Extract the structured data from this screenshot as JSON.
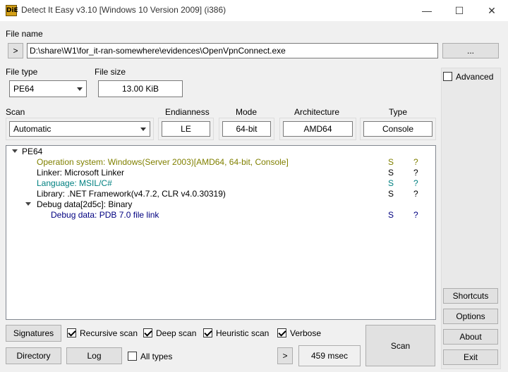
{
  "window": {
    "title": "Detect It Easy v3.10 [Windows 10 Version 2009] (i386)",
    "icon_text": "DiE",
    "minimize": "—",
    "maximize": "☐",
    "close": "✕"
  },
  "file": {
    "label": "File name",
    "browse_prev": ">",
    "path": "D:\\share\\W1\\for_it-ran-somewhere\\evidences\\OpenVpnConnect.exe",
    "browse_button": "..."
  },
  "file_type": {
    "label": "File type",
    "value": "PE64"
  },
  "file_size": {
    "label": "File size",
    "value": "13.00 KiB"
  },
  "advanced": {
    "label": "Advanced",
    "checked": false
  },
  "scan": {
    "label": "Scan",
    "value": "Automatic"
  },
  "info": {
    "endianness": {
      "label": "Endianness",
      "value": "LE"
    },
    "mode": {
      "label": "Mode",
      "value": "64-bit"
    },
    "architecture": {
      "label": "Architecture",
      "value": "AMD64"
    },
    "type": {
      "label": "Type",
      "value": "Console"
    }
  },
  "results": {
    "root": "PE64",
    "rows": [
      {
        "text": "Operation system: Windows(Server 2003)[AMD64, 64-bit, Console]",
        "s": "S",
        "q": "?",
        "color": "#808000"
      },
      {
        "text": "Linker: Microsoft Linker",
        "s": "S",
        "q": "?",
        "color": "#000000"
      },
      {
        "text": "Language: MSIL/C#",
        "s": "S",
        "q": "?",
        "color": "#008080"
      },
      {
        "text": "Library: .NET Framework(v4.7.2, CLR v4.0.30319)",
        "s": "S",
        "q": "?",
        "color": "#000000"
      }
    ],
    "debug_node": "Debug data[2d5c]: Binary",
    "debug_child": {
      "text": "Debug data: PDB 7.0 file link",
      "s": "S",
      "q": "?",
      "color": "#000080"
    }
  },
  "bottom": {
    "signatures": "Signatures",
    "recursive_scan": "Recursive scan",
    "deep_scan": "Deep scan",
    "heuristic_scan": "Heuristic scan",
    "verbose": "Verbose",
    "directory": "Directory",
    "log": "Log",
    "all_types": "All types",
    "more": ">",
    "time": "459 msec",
    "scan": "Scan"
  },
  "side_buttons": {
    "shortcuts": "Shortcuts",
    "options": "Options",
    "about": "About",
    "exit": "Exit"
  }
}
